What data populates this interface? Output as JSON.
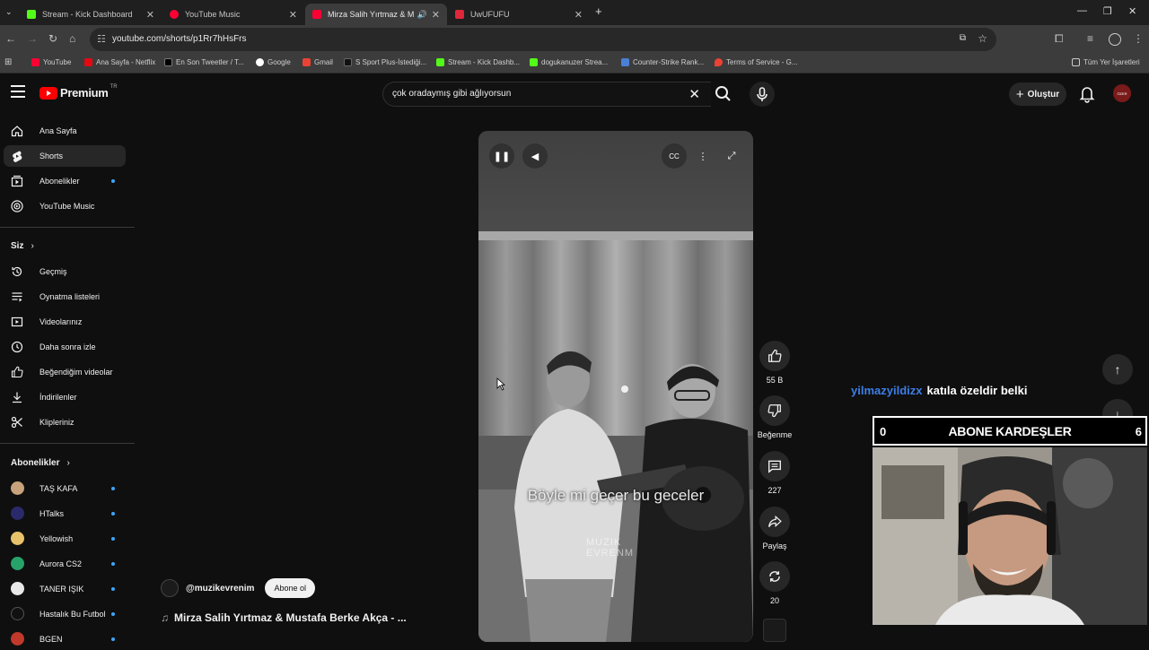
{
  "browser": {
    "tabs": [
      {
        "title": "Stream - Kick Dashboard",
        "color": "#53fc18",
        "active": false
      },
      {
        "title": "YouTube Music",
        "color": "#ff0033",
        "active": false
      },
      {
        "title": "Mirza Salih Yırtmaz & M",
        "color": "#ff0033",
        "active": true
      },
      {
        "title": "UwUFUFU",
        "color": "#e0263a",
        "active": false
      }
    ],
    "url": "youtube.com/shorts/p1Rr7hHsFrs",
    "bookmarks": [
      {
        "label": "YouTube",
        "color": "#ff0033"
      },
      {
        "label": "Ana Sayfa - Netflix",
        "color": "#e50914"
      },
      {
        "label": "En Son Tweetler / T...",
        "color": "#000000"
      },
      {
        "label": "Google",
        "color": "#4285f4"
      },
      {
        "label": "Gmail",
        "color": "#ea4335"
      },
      {
        "label": "S Sport Plus-İstediği...",
        "color": "#111111"
      },
      {
        "label": "Stream - Kick Dashb...",
        "color": "#53fc18"
      },
      {
        "label": "dogukanuzer Strea...",
        "color": "#53fc18"
      },
      {
        "label": "Counter-Strike Rank...",
        "color": "#4a7fd4"
      },
      {
        "label": "Terms of Service - G...",
        "color": "#ea4335"
      }
    ],
    "all_bookmarks": "Tüm Yer İşaretleri"
  },
  "youtube": {
    "logo": "Premium",
    "region": "TR",
    "search_query": "çok oradaymış gibi ağlıyorsun",
    "create_label": "Oluştur",
    "avatar_text": "ÖZER"
  },
  "sidebar": {
    "main": [
      {
        "label": "Ana Sayfa",
        "icon": "home-icon"
      },
      {
        "label": "Shorts",
        "icon": "shorts-icon",
        "selected": true
      },
      {
        "label": "Abonelikler",
        "icon": "subscriptions-icon",
        "dot": true
      },
      {
        "label": "YouTube Music",
        "icon": "youtube-music-icon"
      }
    ],
    "you_heading": "Siz",
    "you": [
      {
        "label": "Geçmiş",
        "icon": "history-icon"
      },
      {
        "label": "Oynatma listeleri",
        "icon": "playlists-icon"
      },
      {
        "label": "Videolarınız",
        "icon": "your-videos-icon"
      },
      {
        "label": "Daha sonra izle",
        "icon": "watch-later-icon"
      },
      {
        "label": "Beğendiğim videolar",
        "icon": "liked-icon"
      },
      {
        "label": "İndirilenler",
        "icon": "downloads-icon"
      },
      {
        "label": "Klipleriniz",
        "icon": "clips-icon"
      }
    ],
    "subs_heading": "Abonelikler",
    "subscriptions": [
      {
        "label": "TAŞ KAFA",
        "color": "#c8a27a"
      },
      {
        "label": "HTalks",
        "color": "#2a2a6a"
      },
      {
        "label": "Yellowish",
        "color": "#e8c26a"
      },
      {
        "label": "Aurora CS2",
        "color": "#27a36a"
      },
      {
        "label": "TANER IŞIK",
        "color": "#e8e8e8"
      },
      {
        "label": "Hastalık Bu Futbol",
        "color": "#111111"
      },
      {
        "label": "BGEN",
        "color": "#c0392b"
      }
    ]
  },
  "short": {
    "subtitle": "Böyle mi geçer bu geceler",
    "watermark_line1": "MUZIK",
    "watermark_line2": "EVRENM",
    "channel_handle": "@muzikevrenim",
    "subscribe_label": "Abone ol",
    "title": "Mirza Salih Yırtmaz & Mustafa Berke Akça - ...",
    "likes": "55 B",
    "dislike_label": "Beğenme",
    "comments": "227",
    "share_label": "Paylaş",
    "remix_count": "20"
  },
  "stream_overlay": {
    "chat_user": "yilmazyildizx",
    "chat_message": "katıla özeldir belki",
    "goal_left": "0",
    "goal_title": "ABONE KARDEŞLER",
    "goal_right": "6"
  }
}
